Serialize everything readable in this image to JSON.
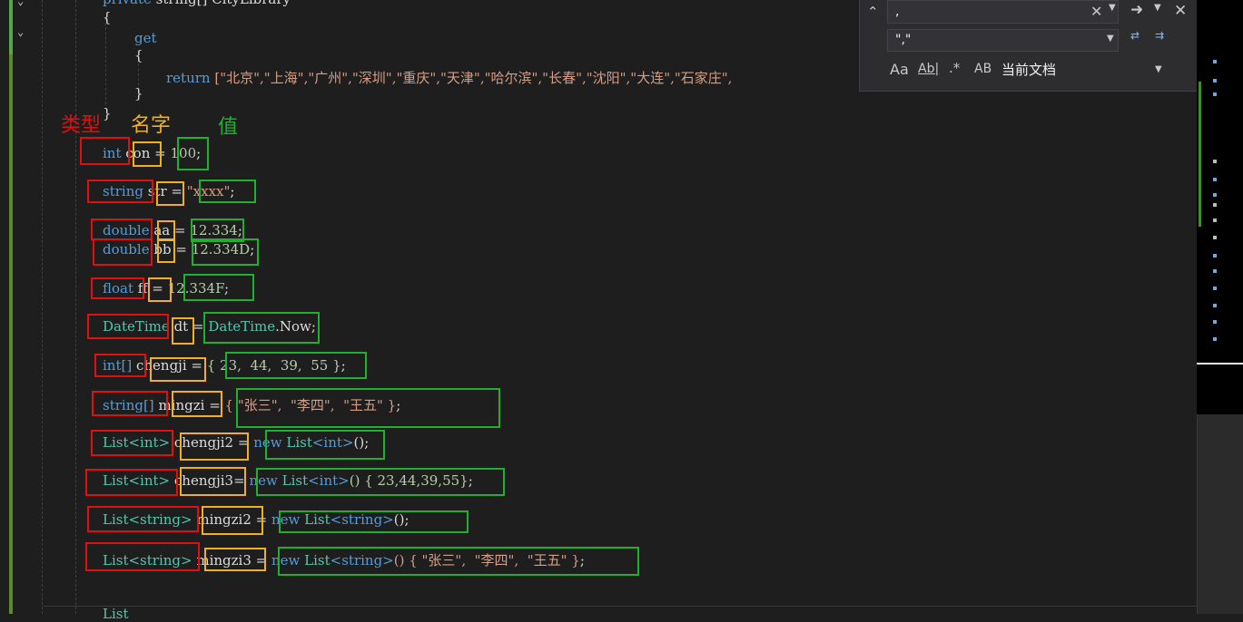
{
  "code": {
    "top": {
      "private_kw": "private",
      "decl_rest": " string[] CityLibrary",
      "open_brace": "{",
      "get": "get",
      "inner_open": "{",
      "return_kw": "return",
      "return_list": " [\"北京\",\"上海\",\"广州\",\"深圳\",\"重庆\",\"天津\",\"哈尔滨\",\"长春\",\"沈阳\",\"大连\",\"石家庄\",",
      "inner_close": "}",
      "close_brace": "}"
    },
    "lines": [
      {
        "type": "int",
        "name": "con",
        "eq": " = ",
        "value": "100",
        "tail": ";"
      },
      {
        "type": "string",
        "name": "str",
        "eq": " = ",
        "value": "\"xxxx\"",
        "tail": ";"
      },
      {
        "type": "double",
        "name": "aa",
        "eq": " = ",
        "value": "12.334",
        "tail": ";"
      },
      {
        "type": "double",
        "name": "bb",
        "eq": " = ",
        "value": "12.334D",
        "tail": ";"
      },
      {
        "type": "float",
        "name": "ff",
        "eq": " = ",
        "value": "12.334F",
        "tail": ";"
      },
      {
        "type": "DateTime",
        "name": "dt",
        "eq": " = ",
        "value_type": "DateTime",
        "value_rest": ".Now",
        "tail": ";"
      },
      {
        "type": "int[]",
        "name": "chengji",
        "eq": " = ",
        "value": "{ 23,  44,  39,  55 }",
        "tail": ";"
      },
      {
        "type": "string[]",
        "name": "mingzi",
        "eq": " = ",
        "value": "{ \"张三\",  \"李四\",  \"王五\" }",
        "tail": ";"
      },
      {
        "type": "List<int>",
        "name": "chengji2",
        "eq": " = ",
        "v_new": "new",
        "v_type": "List",
        "v_gen": "<int>",
        "v_rest": "()",
        "tail": ";"
      },
      {
        "type": "List<int>",
        "name": "chengji3",
        "eq": "= ",
        "v_new": "new",
        "v_type": "List",
        "v_gen": "<int>",
        "v_rest": "() { 23,44,39,55}",
        "tail": ";"
      },
      {
        "type": "List<string>",
        "name": "mingzi2",
        "eq": " = ",
        "v_new": "new",
        "v_type": "List",
        "v_gen": "<string>",
        "v_rest": "()",
        "tail": ";"
      },
      {
        "type": "List<string>",
        "name": "mingzi3",
        "eq": " = ",
        "v_new": "new",
        "v_type": "List",
        "v_gen": "<string>",
        "v_rest": "() { \"张三\",  \"李四\",  \"王五\" }",
        "tail": ";"
      }
    ],
    "bottom_partial": "List"
  },
  "annotations": {
    "type_label": "类型",
    "name_label": "名字",
    "value_label": "值",
    "colors": {
      "type": "#e01010",
      "name": "#f0b020",
      "value": "#20b030"
    }
  },
  "find_panel": {
    "search_value": ",",
    "replace_value": "\",\"",
    "scope": "当前文档",
    "icons": {
      "expand": "chevron-up-icon",
      "clear": "close-icon",
      "options": "chevron-down-icon",
      "next": "arrow-right-icon",
      "next_options": "chevron-down-icon",
      "close": "close-icon",
      "replace_next": "replace-next-icon",
      "replace_all": "replace-all-icon",
      "match_case": "Aa",
      "whole_word": "Ab|",
      "regex": ".*",
      "preserve_case": "AB"
    }
  }
}
